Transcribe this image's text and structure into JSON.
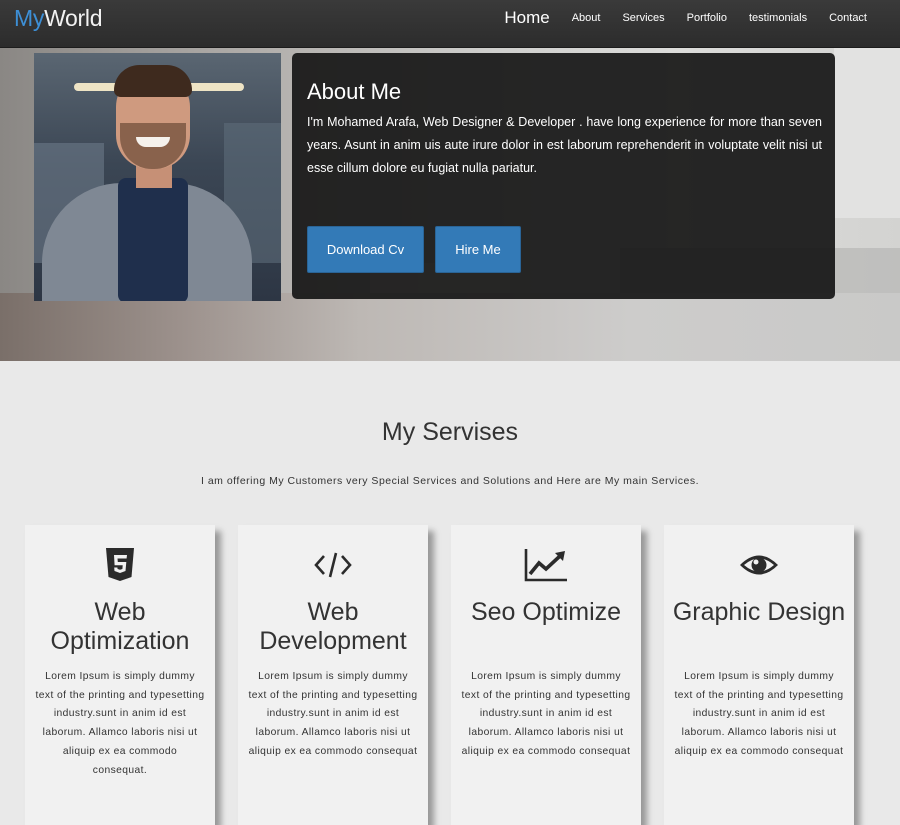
{
  "navbar": {
    "brand_my": "My",
    "brand_world": "World",
    "links": [
      "Home",
      "About",
      "Services",
      "Portfolio",
      "testimonials",
      "Contact"
    ]
  },
  "about": {
    "title": "About Me",
    "text": "I'm Mohamed Arafa, Web Designer & Developer . have long experience for more than seven years. Asunt in anim uis aute irure dolor in est laborum reprehenderit in voluptate velit nisi ut esse cillum dolore eu fugiat nulla pariatur.",
    "download_cv": "Download Cv",
    "hire_me": "Hire Me"
  },
  "services": {
    "title": "My Servises",
    "subtitle": "I am offering My Customers very Special Services and Solutions and Here are My main Services.",
    "cards": [
      {
        "icon": "html5-icon",
        "title": "Web Optimization",
        "text": "Lorem Ipsum is simply dummy text of the printing and typesetting industry.sunt in anim id est laborum. Allamco laboris nisi ut aliquip ex ea commodo consequat."
      },
      {
        "icon": "code-icon",
        "title": "Web Development",
        "text": "Lorem Ipsum is simply dummy text of the printing and typesetting industry.sunt in anim id est laborum. Allamco laboris nisi ut aliquip ex ea commodo consequat"
      },
      {
        "icon": "line-chart-icon",
        "title": "Seo Optimize",
        "text": "Lorem Ipsum is simply dummy text of the printing and typesetting industry.sunt in anim id est laborum. Allamco laboris nisi ut aliquip ex ea commodo consequat"
      },
      {
        "icon": "eye-icon",
        "title": "Graphic Design",
        "text": "Lorem Ipsum is simply dummy text of the printing and typesetting industry.sunt in anim id est laborum. Allamco laboris nisi ut aliquip ex ea commodo consequat"
      }
    ]
  },
  "colors": {
    "accent": "#3d8fd6",
    "button": "#337ab7",
    "navbar": "#333333",
    "card_bg": "#f1f1f1"
  }
}
